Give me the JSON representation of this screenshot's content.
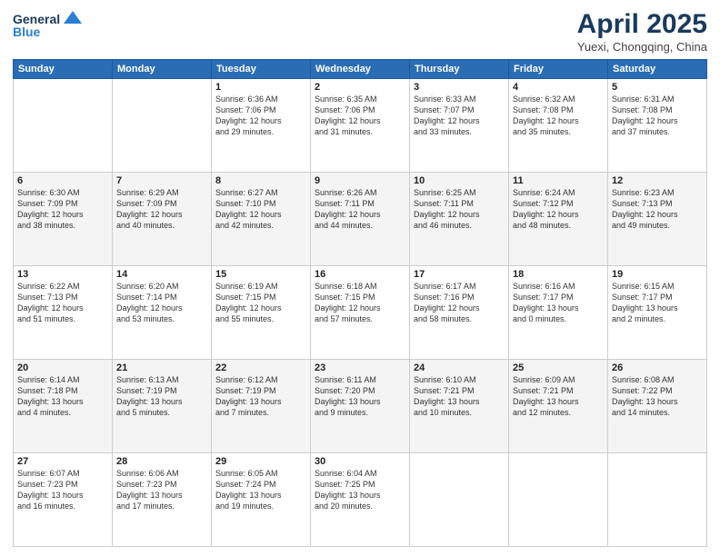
{
  "header": {
    "logo_line1": "General",
    "logo_line2": "Blue",
    "main_title": "April 2025",
    "subtitle": "Yuexi, Chongqing, China"
  },
  "days_of_week": [
    "Sunday",
    "Monday",
    "Tuesday",
    "Wednesday",
    "Thursday",
    "Friday",
    "Saturday"
  ],
  "weeks": [
    [
      {
        "num": "",
        "info": ""
      },
      {
        "num": "",
        "info": ""
      },
      {
        "num": "1",
        "info": "Sunrise: 6:36 AM\nSunset: 7:06 PM\nDaylight: 12 hours\nand 29 minutes."
      },
      {
        "num": "2",
        "info": "Sunrise: 6:35 AM\nSunset: 7:06 PM\nDaylight: 12 hours\nand 31 minutes."
      },
      {
        "num": "3",
        "info": "Sunrise: 6:33 AM\nSunset: 7:07 PM\nDaylight: 12 hours\nand 33 minutes."
      },
      {
        "num": "4",
        "info": "Sunrise: 6:32 AM\nSunset: 7:08 PM\nDaylight: 12 hours\nand 35 minutes."
      },
      {
        "num": "5",
        "info": "Sunrise: 6:31 AM\nSunset: 7:08 PM\nDaylight: 12 hours\nand 37 minutes."
      }
    ],
    [
      {
        "num": "6",
        "info": "Sunrise: 6:30 AM\nSunset: 7:09 PM\nDaylight: 12 hours\nand 38 minutes."
      },
      {
        "num": "7",
        "info": "Sunrise: 6:29 AM\nSunset: 7:09 PM\nDaylight: 12 hours\nand 40 minutes."
      },
      {
        "num": "8",
        "info": "Sunrise: 6:27 AM\nSunset: 7:10 PM\nDaylight: 12 hours\nand 42 minutes."
      },
      {
        "num": "9",
        "info": "Sunrise: 6:26 AM\nSunset: 7:11 PM\nDaylight: 12 hours\nand 44 minutes."
      },
      {
        "num": "10",
        "info": "Sunrise: 6:25 AM\nSunset: 7:11 PM\nDaylight: 12 hours\nand 46 minutes."
      },
      {
        "num": "11",
        "info": "Sunrise: 6:24 AM\nSunset: 7:12 PM\nDaylight: 12 hours\nand 48 minutes."
      },
      {
        "num": "12",
        "info": "Sunrise: 6:23 AM\nSunset: 7:13 PM\nDaylight: 12 hours\nand 49 minutes."
      }
    ],
    [
      {
        "num": "13",
        "info": "Sunrise: 6:22 AM\nSunset: 7:13 PM\nDaylight: 12 hours\nand 51 minutes."
      },
      {
        "num": "14",
        "info": "Sunrise: 6:20 AM\nSunset: 7:14 PM\nDaylight: 12 hours\nand 53 minutes."
      },
      {
        "num": "15",
        "info": "Sunrise: 6:19 AM\nSunset: 7:15 PM\nDaylight: 12 hours\nand 55 minutes."
      },
      {
        "num": "16",
        "info": "Sunrise: 6:18 AM\nSunset: 7:15 PM\nDaylight: 12 hours\nand 57 minutes."
      },
      {
        "num": "17",
        "info": "Sunrise: 6:17 AM\nSunset: 7:16 PM\nDaylight: 12 hours\nand 58 minutes."
      },
      {
        "num": "18",
        "info": "Sunrise: 6:16 AM\nSunset: 7:17 PM\nDaylight: 13 hours\nand 0 minutes."
      },
      {
        "num": "19",
        "info": "Sunrise: 6:15 AM\nSunset: 7:17 PM\nDaylight: 13 hours\nand 2 minutes."
      }
    ],
    [
      {
        "num": "20",
        "info": "Sunrise: 6:14 AM\nSunset: 7:18 PM\nDaylight: 13 hours\nand 4 minutes."
      },
      {
        "num": "21",
        "info": "Sunrise: 6:13 AM\nSunset: 7:19 PM\nDaylight: 13 hours\nand 5 minutes."
      },
      {
        "num": "22",
        "info": "Sunrise: 6:12 AM\nSunset: 7:19 PM\nDaylight: 13 hours\nand 7 minutes."
      },
      {
        "num": "23",
        "info": "Sunrise: 6:11 AM\nSunset: 7:20 PM\nDaylight: 13 hours\nand 9 minutes."
      },
      {
        "num": "24",
        "info": "Sunrise: 6:10 AM\nSunset: 7:21 PM\nDaylight: 13 hours\nand 10 minutes."
      },
      {
        "num": "25",
        "info": "Sunrise: 6:09 AM\nSunset: 7:21 PM\nDaylight: 13 hours\nand 12 minutes."
      },
      {
        "num": "26",
        "info": "Sunrise: 6:08 AM\nSunset: 7:22 PM\nDaylight: 13 hours\nand 14 minutes."
      }
    ],
    [
      {
        "num": "27",
        "info": "Sunrise: 6:07 AM\nSunset: 7:23 PM\nDaylight: 13 hours\nand 16 minutes."
      },
      {
        "num": "28",
        "info": "Sunrise: 6:06 AM\nSunset: 7:23 PM\nDaylight: 13 hours\nand 17 minutes."
      },
      {
        "num": "29",
        "info": "Sunrise: 6:05 AM\nSunset: 7:24 PM\nDaylight: 13 hours\nand 19 minutes."
      },
      {
        "num": "30",
        "info": "Sunrise: 6:04 AM\nSunset: 7:25 PM\nDaylight: 13 hours\nand 20 minutes."
      },
      {
        "num": "",
        "info": ""
      },
      {
        "num": "",
        "info": ""
      },
      {
        "num": "",
        "info": ""
      }
    ]
  ]
}
